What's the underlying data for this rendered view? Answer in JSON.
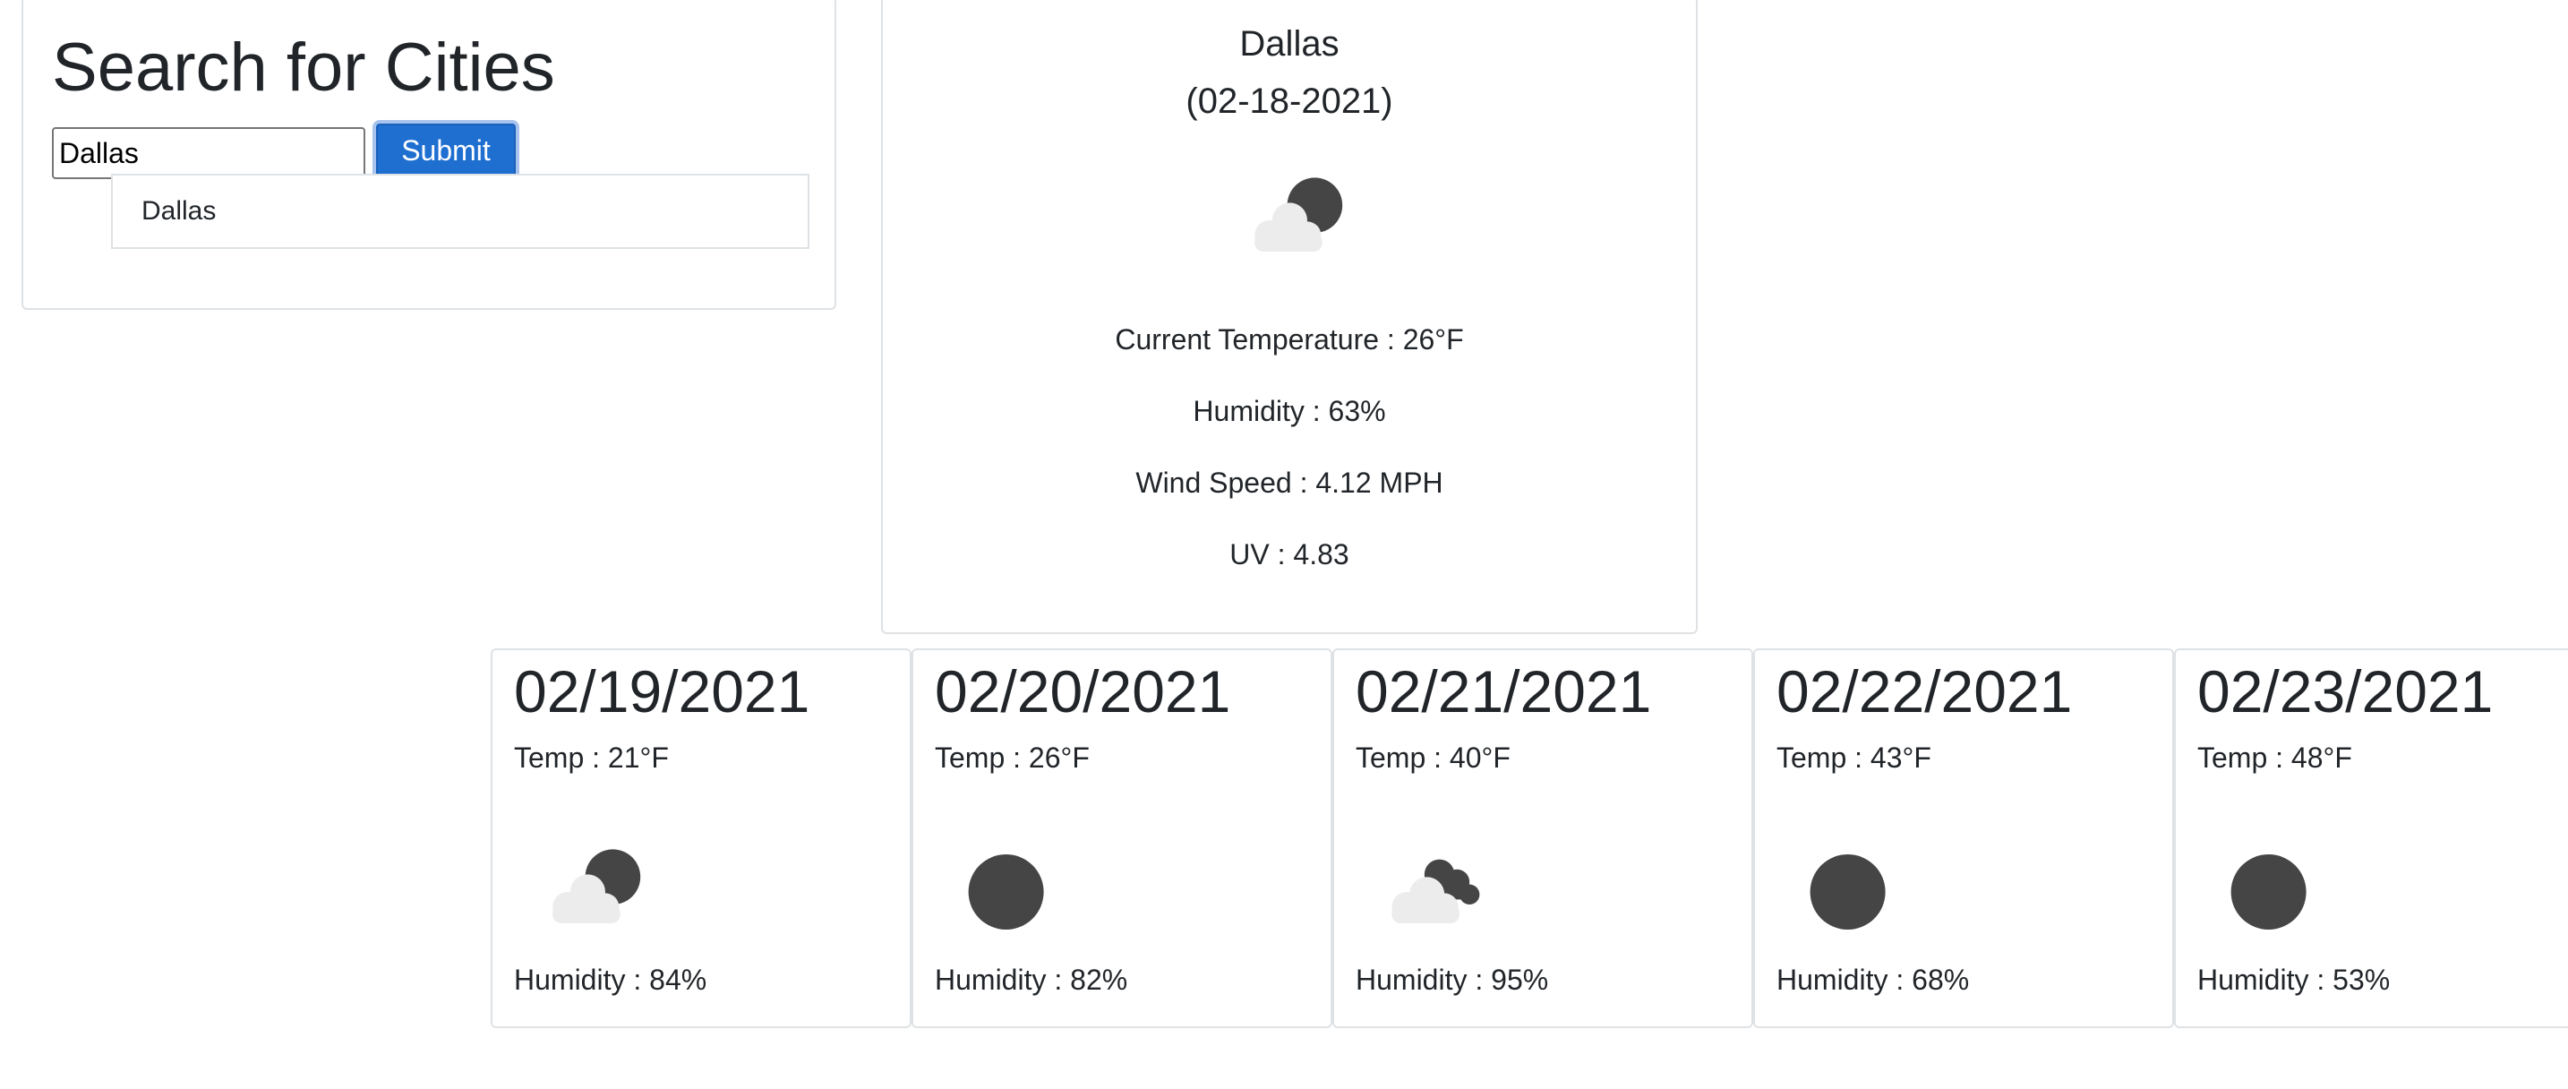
{
  "search": {
    "title": "Search for Cities",
    "input_value": "Dallas",
    "submit_label": "Submit",
    "history": [
      "Dallas"
    ]
  },
  "current": {
    "city": "Dallas",
    "date": "(02-18-2021)",
    "icon": "partly-cloudy-night-icon",
    "temperature": "Current Temperature : 26°F",
    "humidity": "Humidity : 63%",
    "wind": "Wind Speed : 4.12 MPH",
    "uv": "UV : 4.83"
  },
  "forecast": [
    {
      "date": "02/19/2021",
      "temp": "Temp : 21°F",
      "icon": "partly-cloudy-night-icon",
      "humidity": "Humidity : 84%"
    },
    {
      "date": "02/20/2021",
      "temp": "Temp : 26°F",
      "icon": "clear-night-icon",
      "humidity": "Humidity : 82%"
    },
    {
      "date": "02/21/2021",
      "temp": "Temp : 40°F",
      "icon": "broken-clouds-icon",
      "humidity": "Humidity : 95%"
    },
    {
      "date": "02/22/2021",
      "temp": "Temp : 43°F",
      "icon": "clear-night-icon",
      "humidity": "Humidity : 68%"
    },
    {
      "date": "02/23/2021",
      "temp": "Temp : 48°F",
      "icon": "clear-night-icon",
      "humidity": "Humidity : 53%"
    }
  ],
  "colors": {
    "submit_button": "#1f6fd1",
    "border": "#dfe2e5",
    "text": "#212529",
    "icon_dark": "#454545",
    "icon_cloud": "#ececec"
  }
}
